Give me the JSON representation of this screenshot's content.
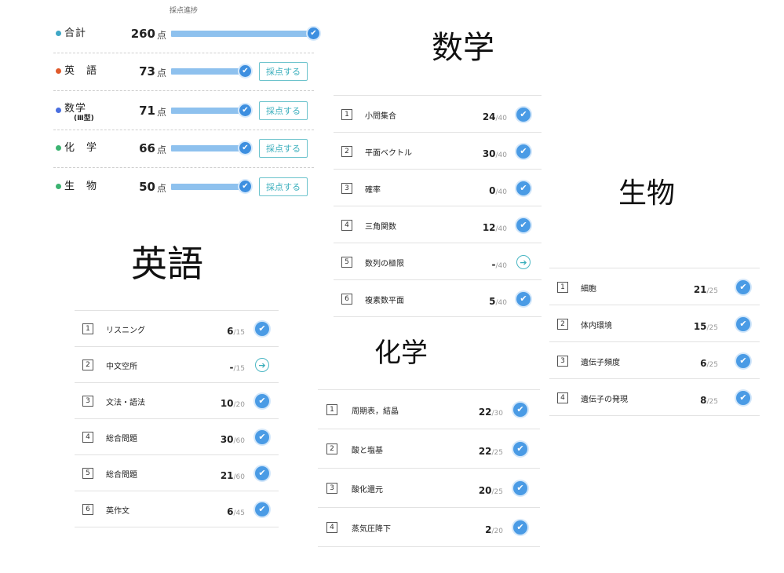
{
  "summary": {
    "title": "採点進捗",
    "unit": "点",
    "score_button_label": "採点する",
    "rows": [
      {
        "name": "合計",
        "sub": "",
        "score": "260",
        "color": "#3fa7c6",
        "progress": 1.0,
        "has_button": false
      },
      {
        "name": "英　語",
        "sub": "",
        "score": "73",
        "color": "#e05a2b",
        "progress": 1.0,
        "has_button": true
      },
      {
        "name": "数学",
        "sub": "(Ⅲ型)",
        "score": "71",
        "color": "#4a6fe0",
        "progress": 1.0,
        "has_button": true
      },
      {
        "name": "化　学",
        "sub": "",
        "score": "66",
        "color": "#3cb371",
        "progress": 1.0,
        "has_button": true
      },
      {
        "name": "生　物",
        "sub": "",
        "score": "50",
        "color": "#3cb371",
        "progress": 1.0,
        "has_button": true
      }
    ]
  },
  "english": {
    "heading": "英語",
    "items": [
      {
        "num": "1",
        "name": "リスニング",
        "score": "6",
        "max": "/15",
        "status": "done"
      },
      {
        "num": "2",
        "name": "中文空所",
        "score": "-",
        "max": "/15",
        "status": "pending"
      },
      {
        "num": "3",
        "name": "文法・語法",
        "score": "10",
        "max": "/20",
        "status": "done"
      },
      {
        "num": "4",
        "name": "総合問題",
        "score": "30",
        "max": "/60",
        "status": "done"
      },
      {
        "num": "5",
        "name": "総合問題",
        "score": "21",
        "max": "/60",
        "status": "done"
      },
      {
        "num": "6",
        "name": "英作文",
        "score": "6",
        "max": "/45",
        "status": "done"
      }
    ]
  },
  "math": {
    "heading": "数学",
    "items": [
      {
        "num": "1",
        "name": "小問集合",
        "score": "24",
        "max": "/40",
        "status": "done"
      },
      {
        "num": "2",
        "name": "平面ベクトル",
        "score": "30",
        "max": "/40",
        "status": "done"
      },
      {
        "num": "3",
        "name": "確率",
        "score": "0",
        "max": "/40",
        "status": "done"
      },
      {
        "num": "4",
        "name": "三角関数",
        "score": "12",
        "max": "/40",
        "status": "done"
      },
      {
        "num": "5",
        "name": "数列の極限",
        "score": "-",
        "max": "/40",
        "status": "pending"
      },
      {
        "num": "6",
        "name": "複素数平面",
        "score": "5",
        "max": "/40",
        "status": "done"
      }
    ]
  },
  "chemistry": {
    "heading": "化学",
    "items": [
      {
        "num": "1",
        "name": "周期表，結晶",
        "score": "22",
        "max": "/30",
        "status": "done"
      },
      {
        "num": "2",
        "name": "酸と塩基",
        "score": "22",
        "max": "/25",
        "status": "done"
      },
      {
        "num": "3",
        "name": "酸化還元",
        "score": "20",
        "max": "/25",
        "status": "done"
      },
      {
        "num": "4",
        "name": "蒸気圧降下",
        "score": "2",
        "max": "/20",
        "status": "done"
      }
    ]
  },
  "biology": {
    "heading": "生物",
    "items": [
      {
        "num": "1",
        "name": "細胞",
        "score": "21",
        "max": "/25",
        "status": "done"
      },
      {
        "num": "2",
        "name": "体内環境",
        "score": "15",
        "max": "/25",
        "status": "done"
      },
      {
        "num": "3",
        "name": "遺伝子頻度",
        "score": "6",
        "max": "/25",
        "status": "done"
      },
      {
        "num": "4",
        "name": "遺伝子の発現",
        "score": "8",
        "max": "/25",
        "status": "done"
      }
    ]
  },
  "icons": {
    "check": "check-icon",
    "arrow": "arrow-right-icon"
  }
}
